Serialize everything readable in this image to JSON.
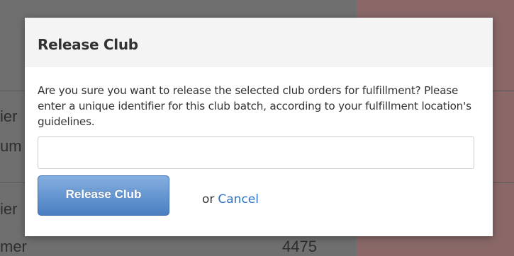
{
  "background": {
    "fragments": [
      "ier",
      "um",
      "ier",
      "mer",
      "4475"
    ]
  },
  "dialog": {
    "title": "Release Club",
    "message": "Are you sure you want to release the selected club orders for fulfillment? Please enter a unique identifier for this club batch, according to your fulfillment location's guidelines.",
    "identifier_value": "",
    "release_button_label": "Release Club",
    "or_text": "or",
    "cancel_label": "Cancel"
  },
  "colors": {
    "primary_button": "#4a7fc2",
    "link": "#2a6fc9",
    "header_bg": "#f4f4f4",
    "overlay_bg": "#6f6f6f"
  }
}
